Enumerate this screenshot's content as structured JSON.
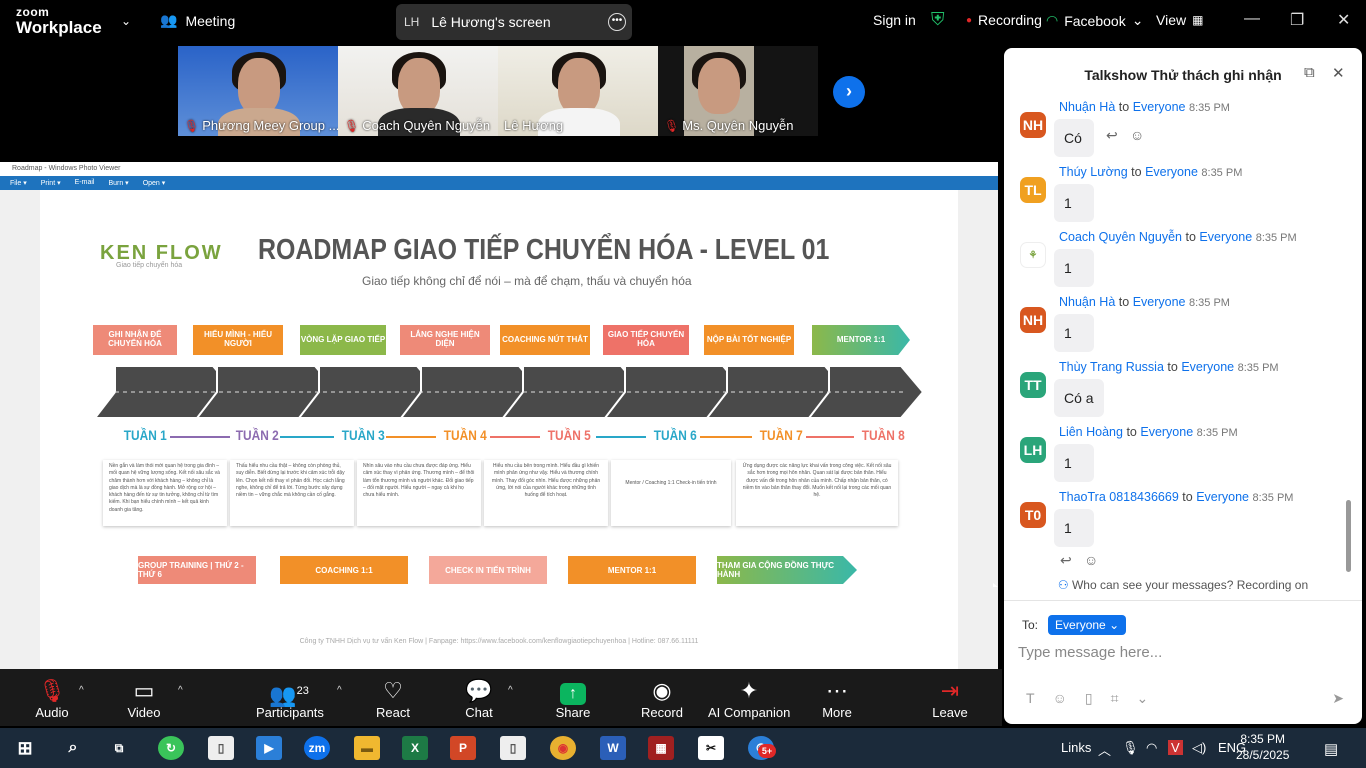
{
  "topbar": {
    "app_small": "zoom",
    "app_big": "Workplace",
    "meeting_label": "Meeting",
    "screen_initials": "LH",
    "screen_label": "Lê Hương's screen",
    "sign_in": "Sign in",
    "recording": "Recording",
    "facebook": "Facebook",
    "view": "View"
  },
  "participants": [
    {
      "name": "Phương Meey Group ...",
      "muted": true
    },
    {
      "name": "Coach Quyên Nguyễn",
      "muted": true
    },
    {
      "name": "Lê Hương",
      "muted": false
    },
    {
      "name": "Ms. Quyên Nguyễn",
      "muted": true
    }
  ],
  "photo_viewer": {
    "title": "Roadmap - Windows Photo Viewer",
    "menu": [
      "File ▾",
      "Print ▾",
      "E-mail",
      "Burn ▾",
      "Open ▾"
    ]
  },
  "slide": {
    "brand": "KEN FLOW",
    "brand_sub": "Giao tiếp chuyển hóa",
    "title": "ROADMAP GIAO TIẾP CHUYỂN HÓA - LEVEL 01",
    "subtitle": "Giao tiếp không chỉ để nói – mà để chạm, thấu và chuyển hóa",
    "stages": [
      "GHI NHẬN ĐỂ CHUYỂN HÓA",
      "HIỂU MÌNH - HIỂU NGƯỜI",
      "VÒNG LẶP GIAO TIẾP",
      "LẮNG NGHE HIỆN DIỆN",
      "COACHING NÚT THẮT",
      "GIAO TIẾP CHUYỂN HÓA",
      "NỘP BÀI TỐT NGHIỆP",
      "MENTOR 1:1"
    ],
    "weeks": [
      "TUẦN 1",
      "TUẦN 2",
      "TUẦN 3",
      "TUẦN 4",
      "TUẦN 5",
      "TUẦN 6",
      "TUẦN 7",
      "TUẦN 8"
    ],
    "boxes": [
      "Nền gắn và làm thói mới quan hệ trong gia đình – mối quan hệ vững lượng sống. Kết nối sâu sắc và chăm thành hơn với khách hàng – không chỉ là giao dịch mà là sự đồng hành. Mở rộng cơ hội – khách hàng đến từ sự tin tưởng, không chỉ từ tìm kiếm. Khi bạn hiểu chính mình – kết quả kinh doanh gia tăng.",
      "Thấu hiểu nhu cầu thật – không còn phòng thủ, suy diễn. Biết dừng lại trước khi cảm xúc trỗi dậy lên. Chọn kết nối thay vì phản đối. Học cách lắng nghe, không chỉ để trả lời. Từng bước xây dựng niềm tin – vững chắc mà không cần cố gắng.",
      "Nhìn sâu vào nhu cầu chưa được đáp ứng. Hiểu cảm xúc thay vì phản ứng. Thương mình – để thôi làm tổn thương mình và người khác. Đối giao tiếp – đối mặt người. Hiểu người – ngay cả khi họ chưa hiểu mình.",
      "Hiểu nhu cầu bên trong mình. Hiểu đầu gì khiến mình phản ứng như vậy. Hiểu và thương chính mình. Thay đổi góc nhìn. Hiểu được những phản ứng, lời nói của người khác trong những tình huống để tích hoạt.",
      "Mentor / Coaching 1:1 Check-in tiến trình",
      "Ứng dụng được các năng lực khai vấn trong công việc. Kết nối sâu sắc hơn trong mọi hôn nhân. Quan sát lại được bản thân. Hiểu được vấn đề trong hôn nhân của mình. Chấp nhận bản thân, có niềm tin vào bản thân thay đổi. Muốn kết nối lại trong các mối quan hệ."
    ],
    "bottom_pills": [
      "GROUP TRAINING | THỨ 2 - THỨ 6",
      "COACHING 1:1",
      "CHECK IN TIẾN TRÌNH",
      "MENTOR 1:1",
      "THAM GIA CỘNG ĐỒNG THỰC HÀNH"
    ],
    "footer": "Công ty TNHH Dịch vụ tư vấn Ken Flow | Fanpage: https://www.facebook.com/kenflowgiaotiepchuyenhoa | Hotline: 087.66.11111"
  },
  "toolbar": {
    "audio": "Audio",
    "video": "Video",
    "participants": "Participants",
    "participant_count": "23",
    "react": "React",
    "chat": "Chat",
    "share": "Share",
    "record": "Record",
    "ai": "AI Companion",
    "more": "More",
    "leave": "Leave"
  },
  "chat": {
    "title": "Talkshow Thử thách ghi nhận",
    "messages": [
      {
        "initials": "NH",
        "color": "#d8571f",
        "name": "Nhuận Hà",
        "to": "to",
        "target": "Everyone",
        "time": "8:35 PM",
        "text": "Có",
        "reactions": true
      },
      {
        "initials": "TL",
        "color": "#f0a020",
        "name": "Thúy Lường",
        "to": "to",
        "target": "Everyone",
        "time": "8:35 PM",
        "text": "1"
      },
      {
        "initials": "",
        "color": "#ffffff",
        "name": "Coach Quyên Nguyễn",
        "to": "to",
        "target": "Everyone",
        "time": "8:35 PM",
        "text": "1"
      },
      {
        "initials": "NH",
        "color": "#d8571f",
        "name": "Nhuận Hà",
        "to": "to",
        "target": "Everyone",
        "time": "8:35 PM",
        "text": "1"
      },
      {
        "initials": "TT",
        "color": "#2aa57a",
        "name": "Thùy Trang Russia",
        "to": "to",
        "target": "Everyone",
        "time": "8:35 PM",
        "text": "Có a"
      },
      {
        "initials": "LH",
        "color": "#2aa57a",
        "name": "Liên Hoàng",
        "to": "to",
        "target": "Everyone",
        "time": "8:35 PM",
        "text": "1"
      },
      {
        "initials": "T0",
        "color": "#d8571f",
        "name": "ThaoTra 0818436669",
        "to": "to",
        "target": "Everyone",
        "time": "8:35 PM",
        "text": "1",
        "reactions": true
      }
    ],
    "who_can_see": "Who can see your messages? Recording on",
    "to_label": "To:",
    "to_value": "Everyone",
    "placeholder": "Type message here..."
  },
  "taskbar": {
    "links": "Links",
    "lang": "ENG",
    "time": "8:35 PM",
    "date": "28/5/2025",
    "badge": "5+"
  }
}
